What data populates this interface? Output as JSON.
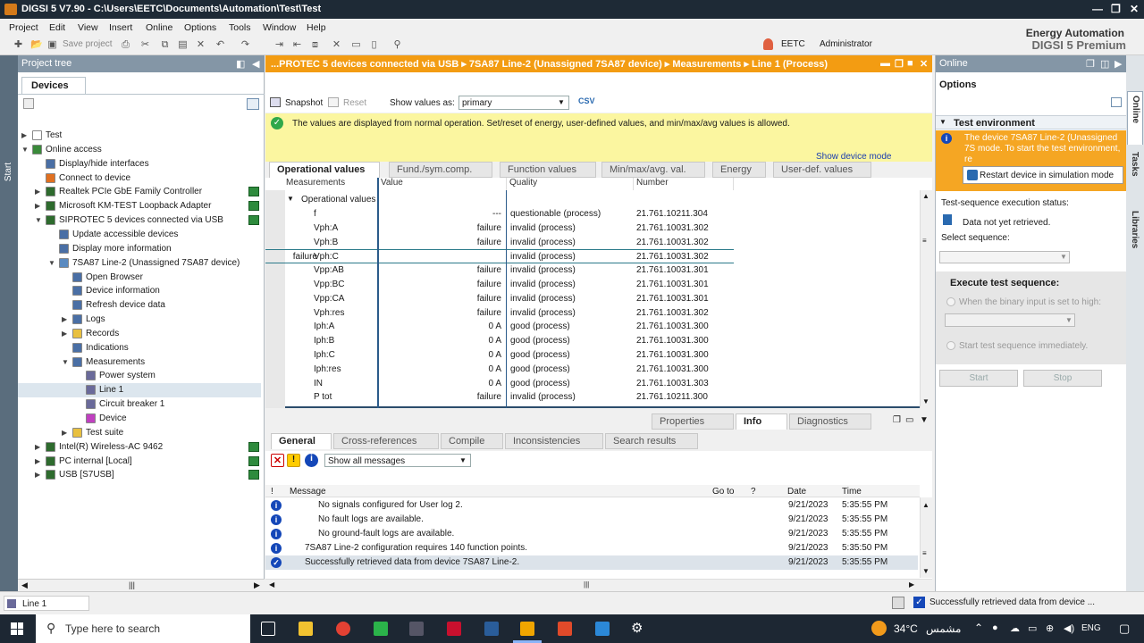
{
  "window": {
    "title": "DIGSI 5 V7.90  -  C:\\Users\\EETC\\Documents\\Automation\\Test\\Test"
  },
  "menu": [
    "Project",
    "Edit",
    "View",
    "Insert",
    "Online",
    "Options",
    "Tools",
    "Window",
    "Help"
  ],
  "toolbar": {
    "save_label": "Save project",
    "user_name": "EETC",
    "role": "Administrator"
  },
  "brand": {
    "line1": "Energy Automation",
    "line2": "DIGSI 5 Premium"
  },
  "start_label": "Start",
  "project_tree": {
    "header": "Project tree",
    "tab": "Devices",
    "items": [
      {
        "label": "Test",
        "level": 0,
        "arrow": "▶",
        "color": "#ffffff",
        "status": false
      },
      {
        "label": "Online access",
        "level": 0,
        "arrow": "▼",
        "color": "#3a8a3a",
        "status": false
      },
      {
        "label": "Display/hide interfaces",
        "level": 1,
        "arrow": "",
        "color": "#4a6fa5",
        "status": false
      },
      {
        "label": "Connect to device",
        "level": 1,
        "arrow": "",
        "color": "#e07020",
        "status": false
      },
      {
        "label": "Realtek PCIe GbE Family Controller",
        "level": 1,
        "arrow": "▶",
        "color": "#2e6b2e",
        "status": true
      },
      {
        "label": "Microsoft KM-TEST Loopback Adapter",
        "level": 1,
        "arrow": "▶",
        "color": "#2e6b2e",
        "status": true
      },
      {
        "label": "SIPROTEC 5 devices connected via USB",
        "level": 1,
        "arrow": "▼",
        "color": "#2e6b2e",
        "status": true
      },
      {
        "label": "Update accessible devices",
        "level": 2,
        "arrow": "",
        "color": "#4a6fa5",
        "status": false
      },
      {
        "label": "Display more information",
        "level": 2,
        "arrow": "",
        "color": "#4a6fa5",
        "status": false
      },
      {
        "label": "7SA87 Line-2 (Unassigned 7SA87 device)",
        "level": 2,
        "arrow": "▼",
        "color": "#5a8ac0",
        "status": false
      },
      {
        "label": "Open Browser",
        "level": 3,
        "arrow": "",
        "color": "#4a6fa5",
        "status": false
      },
      {
        "label": "Device information",
        "level": 3,
        "arrow": "",
        "color": "#4a6fa5",
        "status": false
      },
      {
        "label": "Refresh device data",
        "level": 3,
        "arrow": "",
        "color": "#4a6fa5",
        "status": false
      },
      {
        "label": "Logs",
        "level": 3,
        "arrow": "▶",
        "color": "#4a6fa5",
        "status": false
      },
      {
        "label": "Records",
        "level": 3,
        "arrow": "▶",
        "color": "#e8c040",
        "status": false
      },
      {
        "label": "Indications",
        "level": 3,
        "arrow": "",
        "color": "#4a6fa5",
        "status": false
      },
      {
        "label": "Measurements",
        "level": 3,
        "arrow": "▼",
        "color": "#4a6fa5",
        "status": false
      },
      {
        "label": "Power system",
        "level": 4,
        "arrow": "",
        "color": "#6a6a9a",
        "status": false
      },
      {
        "label": "Line 1",
        "level": 4,
        "arrow": "",
        "color": "#6a6a9a",
        "status": false
      },
      {
        "label": "Circuit breaker 1",
        "level": 4,
        "arrow": "",
        "color": "#6a6a9a",
        "status": false
      },
      {
        "label": "Device",
        "level": 4,
        "arrow": "",
        "color": "#c040c0",
        "status": false
      },
      {
        "label": "Test suite",
        "level": 3,
        "arrow": "▶",
        "color": "#e8c040",
        "status": false
      },
      {
        "label": "Intel(R) Wireless-AC 9462",
        "level": 1,
        "arrow": "▶",
        "color": "#2e6b2e",
        "status": true
      },
      {
        "label": "PC internal [Local]",
        "level": 1,
        "arrow": "▶",
        "color": "#2e6b2e",
        "status": true
      },
      {
        "label": "USB [S7USB]",
        "level": 1,
        "arrow": "▶",
        "color": "#2e6b2e",
        "status": true
      }
    ]
  },
  "main": {
    "breadcrumb": "...PROTEC 5 devices connected via USB  ▸  7SA87 Line-2 (Unassigned 7SA87 device)  ▸  Measurements  ▸  Line 1 (Process)",
    "snapshot": "Snapshot",
    "reset": "Reset",
    "show_values_label": "Show values as:",
    "show_values_value": "primary",
    "banner": "The values are displayed from normal operation. Set/reset of energy, user-defined values, and min/max/avg values is allowed.",
    "show_device_mode": "Show device mode",
    "tabs": [
      "Operational values",
      "Fund./sym.comp.",
      "Function values",
      "Min/max/avg. val.",
      "Energy",
      "User-def. values"
    ],
    "columns": [
      "Measurements",
      "Value",
      "Quality",
      "Number"
    ],
    "group": "Operational values",
    "rows": [
      {
        "m": "f",
        "v": "---",
        "q": "questionable (process)",
        "n": "21.761.10211.304"
      },
      {
        "m": "Vph:A",
        "v": "failure",
        "q": "invalid (process)",
        "n": "21.761.10031.302"
      },
      {
        "m": "Vph:B",
        "v": "failure",
        "q": "invalid (process)",
        "n": "21.761.10031.302"
      },
      {
        "m": "Vph:C",
        "v": "failure",
        "q": "invalid (process)",
        "n": "21.761.10031.302"
      },
      {
        "m": "Vpp:AB",
        "v": "failure",
        "q": "invalid (process)",
        "n": "21.761.10031.301"
      },
      {
        "m": "Vpp:BC",
        "v": "failure",
        "q": "invalid (process)",
        "n": "21.761.10031.301"
      },
      {
        "m": "Vpp:CA",
        "v": "failure",
        "q": "invalid (process)",
        "n": "21.761.10031.301"
      },
      {
        "m": "Vph:res",
        "v": "failure",
        "q": "invalid (process)",
        "n": "21.761.10031.302"
      },
      {
        "m": "Iph:A",
        "v": "0 A",
        "q": "good (process)",
        "n": "21.761.10031.300"
      },
      {
        "m": "Iph:B",
        "v": "0 A",
        "q": "good (process)",
        "n": "21.761.10031.300"
      },
      {
        "m": "Iph:C",
        "v": "0 A",
        "q": "good (process)",
        "n": "21.761.10031.300"
      },
      {
        "m": "Iph:res",
        "v": "0 A",
        "q": "good (process)",
        "n": "21.761.10031.300"
      },
      {
        "m": "IN",
        "v": "0 A",
        "q": "good (process)",
        "n": "21.761.10031.303"
      },
      {
        "m": "P tot",
        "v": "failure",
        "q": "invalid (process)",
        "n": "21.761.10211.300"
      }
    ]
  },
  "inspector": {
    "tabs": [
      "Properties",
      "Info",
      "Diagnostics"
    ],
    "subtabs": [
      "General",
      "Cross-references",
      "Compile",
      "Inconsistencies",
      "Search results"
    ],
    "filter": "Show all messages",
    "columns": [
      "!",
      "Message",
      "Go to",
      "?",
      "Date",
      "Time"
    ],
    "messages": [
      {
        "text": "No signals configured for User log 2.",
        "date": "9/21/2023",
        "time": "5:35:55 PM",
        "indent": true,
        "kind": "info"
      },
      {
        "text": "No fault logs are available.",
        "date": "9/21/2023",
        "time": "5:35:55 PM",
        "indent": true,
        "kind": "info"
      },
      {
        "text": "No ground-fault logs are available.",
        "date": "9/21/2023",
        "time": "5:35:55 PM",
        "indent": true,
        "kind": "info"
      },
      {
        "text": "7SA87 Line-2 configuration requires 140 function points.",
        "date": "9/21/2023",
        "time": "5:35:50 PM",
        "indent": false,
        "kind": "info"
      },
      {
        "text": "Successfully retrieved data from device 7SA87 Line-2.",
        "date": "9/21/2023",
        "time": "5:35:55 PM",
        "indent": false,
        "kind": "ok"
      }
    ]
  },
  "online_panel": {
    "header": "Online",
    "options": "Options",
    "test_env": "Test environment",
    "warning": "The device 7SA87 Line-2 (Unassigned 7S mode. To start the test environment, re",
    "restart": "Restart device in simulation mode",
    "exec_status_label": "Test-sequence execution status:",
    "exec_status": "Data not yet retrieved.",
    "select_seq": "Select sequence:",
    "execute_title": "Execute test sequence:",
    "radio1": "When the binary input is set to high:",
    "radio2": "Start test sequence immediately.",
    "start": "Start",
    "stop": "Stop"
  },
  "side_tabs": [
    "Online",
    "Tasks",
    "Libraries"
  ],
  "status_bar": {
    "editor": "Line 1",
    "message": "Successfully retrieved data from device ..."
  },
  "taskbar": {
    "search": "Type here to search",
    "weather": "34°C",
    "weather_text": "مشمس",
    "lang": "ENG"
  }
}
